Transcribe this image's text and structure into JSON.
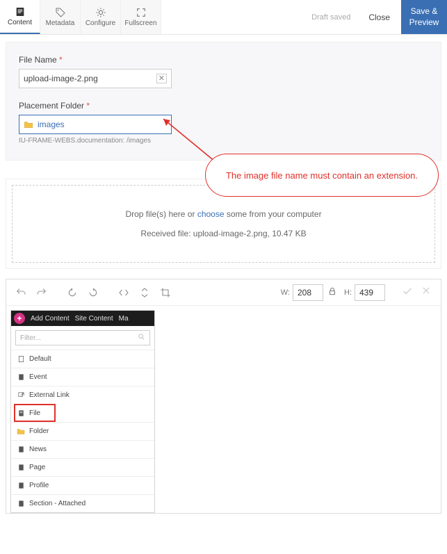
{
  "toolbar": {
    "tabs": {
      "content": "Content",
      "metadata": "Metadata",
      "configure": "Configure",
      "fullscreen": "Fullscreen"
    },
    "draft_saved": "Draft saved",
    "close": "Close",
    "save_preview": "Save & Preview"
  },
  "form": {
    "file_name_label": "File Name",
    "file_name_value": "upload-image-2.png",
    "placement_label": "Placement Folder",
    "placement_value": "images",
    "placement_path": "IU-FRAME-WEBS.documentation: /images"
  },
  "callout_text": "The image file name must contain an extension.",
  "dropzone": {
    "line_before": "Drop file(s) here or ",
    "choose": "choose",
    "line_after": " some from your computer",
    "received": "Received file: upload-image-2.png, 10.47 KB"
  },
  "editor_dims": {
    "w_label": "W:",
    "w_value": "208",
    "h_label": "H:",
    "h_value": "439"
  },
  "inner": {
    "add_content": "Add Content",
    "site_content": "Site Content",
    "trailing": "Ma",
    "filter_placeholder": "Filter...",
    "items": {
      "default": "Default",
      "event": "Event",
      "external_link": "External Link",
      "file": "File",
      "folder": "Folder",
      "news": "News",
      "page": "Page",
      "profile": "Profile",
      "section": "Section - Attached"
    }
  }
}
